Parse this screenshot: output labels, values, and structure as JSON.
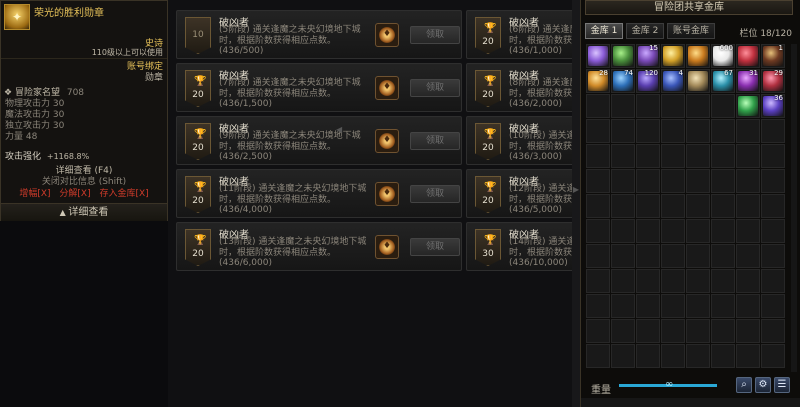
{
  "tooltip": {
    "item_name": "荣光的胜利勋章",
    "rarity": "史诗",
    "level_req": "110级以上可以使用",
    "bind": "账号绑定",
    "kind": "勋章",
    "fame_label": "冒险家名望",
    "fame_value": "708",
    "stats": [
      {
        "label": "物理攻击力",
        "value": "30"
      },
      {
        "label": "魔法攻击力",
        "value": "30"
      },
      {
        "label": "独立攻击力",
        "value": "30"
      },
      {
        "label": "力量",
        "value": "48"
      }
    ],
    "enhance_label": "攻击强化",
    "enhance_value": "+1168.8%",
    "detail_hint": "详细查看 (F4)",
    "close_hint": "关闭对比信息 (Shift)",
    "actions": [
      "增幅[X]",
      "分解[X]",
      "存入金库[X]"
    ],
    "detail_button": "详细查看"
  },
  "quests": {
    "claim_label": "领取",
    "title": "破凶者",
    "left": [
      {
        "level": "10",
        "stage": "(5阶段)",
        "desc": "通关逢魔之未央幻境地下城时，根据阶数获得相应点数。",
        "progress": "(436/500)",
        "dim": true
      },
      {
        "level": "20",
        "stage": "(7阶段)",
        "desc": "通关逢魔之未央幻境地下城时，根据阶数获得相应点数。",
        "progress": "(436/1,500)"
      },
      {
        "level": "20",
        "stage": "(9阶段)",
        "desc": "通关逢魔之未央幻境地下城时，根据阶数获得相应点数。",
        "progress": "(436/2,500)"
      },
      {
        "level": "20",
        "stage": "(11阶段)",
        "desc": "通关逢魔之未央幻境地下城时，根据阶数获得相应点数。",
        "progress": "(436/4,000)"
      },
      {
        "level": "20",
        "stage": "(13阶段)",
        "desc": "通关逢魔之未央幻境地下城时，根据阶数获得相应点数。",
        "progress": "(436/6,000)"
      }
    ],
    "right": [
      {
        "level": "20",
        "stage": "(6阶段)",
        "desc": "通关逢魔之未央幻境地下城时，根据阶数获",
        "progress": "(436/1,000)"
      },
      {
        "level": "20",
        "stage": "(8阶段)",
        "desc": "通关逢魔之未央幻境地下城时，根据阶数获",
        "progress": "(436/2,000)"
      },
      {
        "level": "20",
        "stage": "(10阶段)",
        "desc": "通关逢魔之未央幻境地下城时，根据阶数获",
        "progress": "(436/3,000)"
      },
      {
        "level": "20",
        "stage": "(12阶段)",
        "desc": "通关逢魔之未央幻境地下城时，根据阶数获",
        "progress": "(436/5,000)"
      },
      {
        "level": "30",
        "stage": "(14阶段)",
        "desc": "通关逢魔之未央幻境地下城时，根据阶数获",
        "progress": "(436/10,000)"
      }
    ]
  },
  "storage": {
    "title": "冒险团共享金库",
    "tabs": [
      "金库 1",
      "金库 2",
      "账号金库"
    ],
    "active_tab": 0,
    "slot_label": "栏位",
    "slot_count": "18/120",
    "weight_label": "重量",
    "weight_value": "∞",
    "weight_fill": 1.0,
    "items": [
      {
        "color": "#8a5bd6",
        "accent": "#d9c3ff",
        "count": ""
      },
      {
        "color": "#4a8f3c",
        "accent": "#a8f08a",
        "count": ""
      },
      {
        "color": "#7a4ab8",
        "accent": "#c9a8ff",
        "count": "15"
      },
      {
        "color": "#d2a028",
        "accent": "#fff0a0",
        "count": ""
      },
      {
        "color": "#c97a1e",
        "accent": "#ffdd88",
        "count": ""
      },
      {
        "color": "#e8e8e8",
        "accent": "#ffffff",
        "count": "600"
      },
      {
        "color": "#c0303e",
        "accent": "#ff8f9a",
        "count": ""
      },
      {
        "color": "#6e3a22",
        "accent": "#e6c07a",
        "count": "1"
      },
      {
        "color": "#d08a28",
        "accent": "#ffe29a",
        "count": "28"
      },
      {
        "color": "#2d6fb8",
        "accent": "#9cd3ff",
        "count": "74"
      },
      {
        "color": "#5a3fb0",
        "accent": "#bba8ff",
        "count": "120"
      },
      {
        "color": "#3a56b8",
        "accent": "#a8c0ff",
        "count": "4"
      },
      {
        "color": "#a38a5a",
        "accent": "#f3e3b8",
        "count": ""
      },
      {
        "color": "#2a8fa8",
        "accent": "#b3f2ff",
        "count": "67"
      },
      {
        "color": "#8a2fb0",
        "accent": "#eaa8ff",
        "count": "31"
      },
      {
        "color": "#b03040",
        "accent": "#ff9ab0",
        "count": "29"
      },
      {
        "color": "#30a04a",
        "accent": "#b8ffb8",
        "count": ""
      },
      {
        "color": "#5a3fc0",
        "accent": "#cbb8ff",
        "count": "36"
      }
    ]
  }
}
